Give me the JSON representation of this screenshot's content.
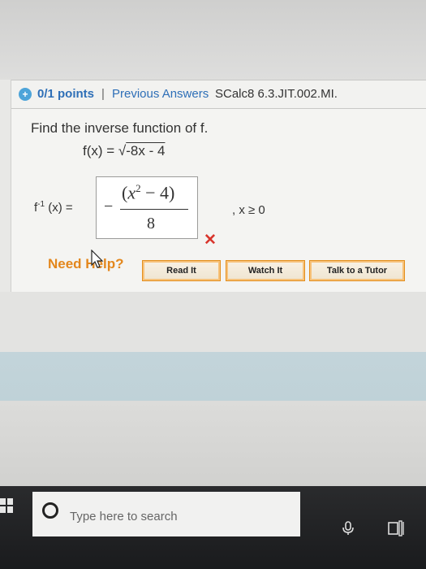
{
  "header": {
    "status_icon": "plus-icon",
    "status_glyph": "+",
    "points": "0/1 points",
    "separator": "|",
    "previous_answers": "Previous Answers",
    "course_code": "SCalc8 6.3.JIT.002.MI."
  },
  "question": {
    "prompt": "Find the inverse function of f.",
    "fx_prefix": "f(x) = √",
    "fx_radicand": "-8x - 4",
    "finv_f": "f",
    "finv_sup": "-1",
    "finv_rest": " (x) =",
    "answer": {
      "sign": "−",
      "num_open": "(",
      "num_var": "x",
      "num_exp": "2",
      "num_rest": " − 4",
      "num_close": ")",
      "denominator": "8"
    },
    "domain": ", x ≥ 0",
    "result_mark": "✕",
    "result_color": "#d8352c"
  },
  "help": {
    "label": "Need Help?",
    "read_it": "Read It",
    "watch_it": "Watch It",
    "talk_to_tutor": "Talk to a Tutor",
    "accent": "#e3871d"
  },
  "taskbar": {
    "search_placeholder": "Type here to search",
    "icons": [
      "windows-start-icon",
      "search-circle-icon",
      "microphone-icon",
      "task-view-icon"
    ]
  }
}
